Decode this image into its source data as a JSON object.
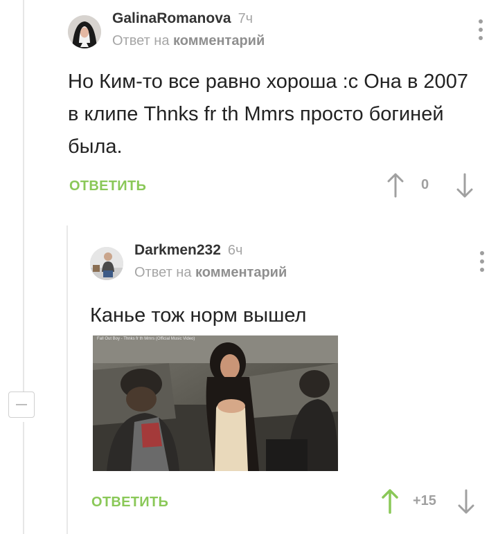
{
  "comments": [
    {
      "author": "GalinaRomanova",
      "time": "7ч",
      "reply_prefix": "Ответ на",
      "reply_target": "комментарий",
      "text": "Но Ким-то все равно хороша :с Она в 2007 в клипе Thnks fr th Mmrs просто богиней была.",
      "reply_label": "ОТВЕТИТЬ",
      "score": "0",
      "upvoted": false
    },
    {
      "author": "Darkmen232",
      "time": "6ч",
      "reply_prefix": "Ответ на",
      "reply_target": "комментарий",
      "text": "Канье тож норм вышел",
      "embed_title": "Fall Out Boy - Thnks fr th Mmrs (Official Music Video)",
      "reply_label": "ОТВЕТИТЬ",
      "score": "+15",
      "upvoted": true
    }
  ],
  "icons": {
    "up": "arrow-up-icon",
    "down": "arrow-down-icon",
    "menu": "more-vertical-icon",
    "collapse": "collapse-minus-icon"
  },
  "colors": {
    "accent_green": "#8ac858",
    "muted_gray": "#a5a5a5",
    "text": "#222222"
  }
}
